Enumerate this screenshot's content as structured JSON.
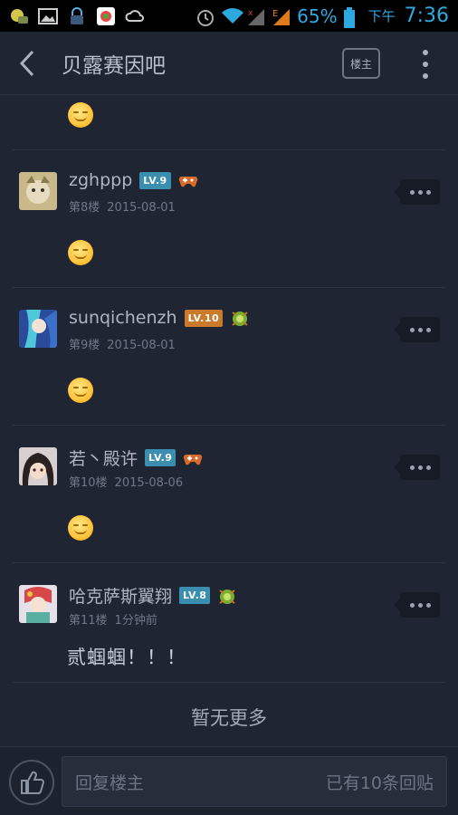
{
  "status_bar": {
    "battery": "65%",
    "ampm": "下午",
    "time": "7:36",
    "net_label": "E"
  },
  "header": {
    "title": "贝露赛因吧",
    "owner_button": "楼主"
  },
  "posts": [
    {
      "username": "zghppp",
      "level": "LV.9",
      "level_color": "#3a8fb0",
      "badge_icon": "gamepad-icon",
      "floor": "第8楼",
      "date": "2015-08-01",
      "content": "smile-emoji"
    },
    {
      "username": "sunqichenzh",
      "level": "LV.10",
      "level_color": "#c97a2b",
      "badge_icon": "green-bug-icon",
      "floor": "第9楼",
      "date": "2015-08-01",
      "content": "smile-emoji"
    },
    {
      "username": "若丶殿许",
      "level": "LV.9",
      "level_color": "#3a8fb0",
      "badge_icon": "gamepad-icon",
      "floor": "第10楼",
      "date": "2015-08-06",
      "content": "smile-emoji"
    },
    {
      "username": "哈克萨斯翼翔",
      "level": "LV.8",
      "level_color": "#3a8fb0",
      "badge_icon": "green-bug-icon",
      "floor": "第11楼",
      "date": "1分钟前",
      "text": "贰蝈蝈！！！"
    }
  ],
  "footer_message": "暂无更多",
  "bottom_bar": {
    "reply_placeholder": "回复楼主",
    "reply_count": "已有10条回贴"
  },
  "colors": {
    "background": "#1f2533",
    "status_accent": "#2ea8e0"
  }
}
